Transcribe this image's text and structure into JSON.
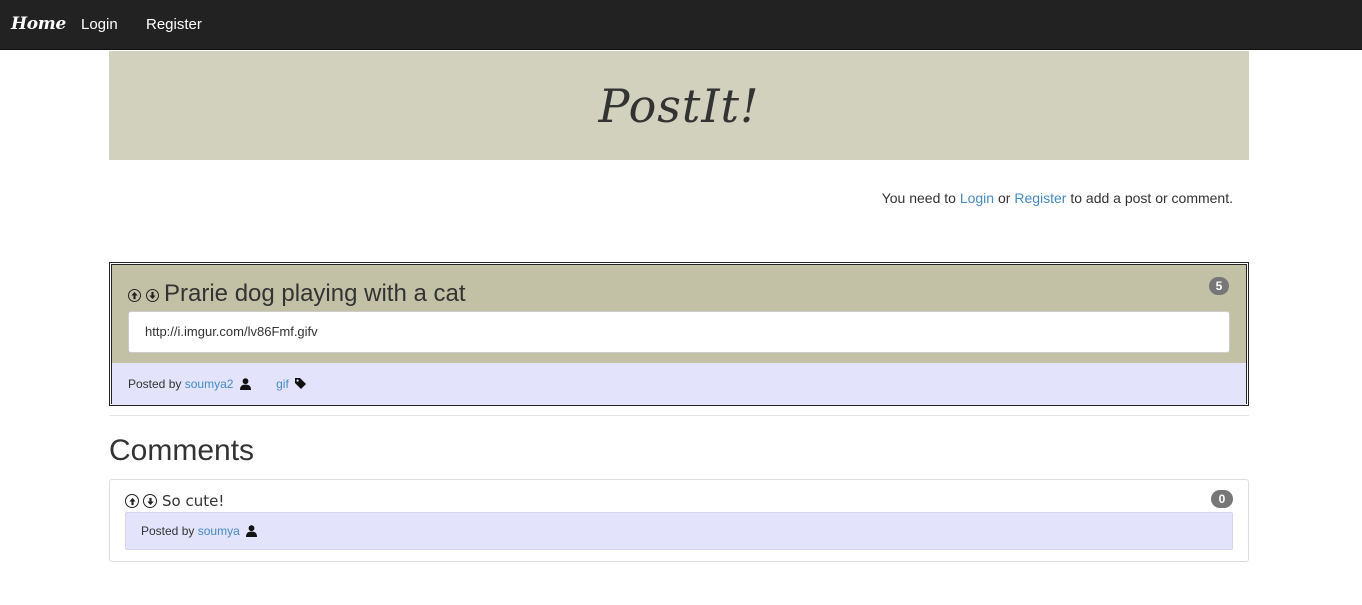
{
  "navbar": {
    "brand": "Home",
    "login": "Login",
    "register": "Register"
  },
  "banner": {
    "logo": "PostIt!"
  },
  "notice": {
    "prefix": "You need to",
    "login": "Login",
    "or": "or",
    "register": "Register",
    "suffix": "to add a post or comment."
  },
  "post": {
    "title": "Prarie dog playing with a cat",
    "comment_count": "5",
    "url": "http://i.imgur.com/lv86Fmf.gifv",
    "posted_by_label": "Posted by",
    "author": "soumya2",
    "tag": "gif",
    "up_icon": "arrow-up-circle-icon",
    "down_icon": "arrow-down-circle-icon"
  },
  "comments": {
    "heading": "Comments",
    "items": [
      {
        "text": "So cute!",
        "votes": "0",
        "posted_by_label": "Posted by",
        "author": "soumya"
      }
    ]
  },
  "colors": {
    "navbar": "#222222",
    "banner": "#d1d1bd",
    "post_head": "#c2c1a6",
    "footer_lavender": "#e3e3fb",
    "link": "#428bca",
    "badge": "#777777"
  }
}
